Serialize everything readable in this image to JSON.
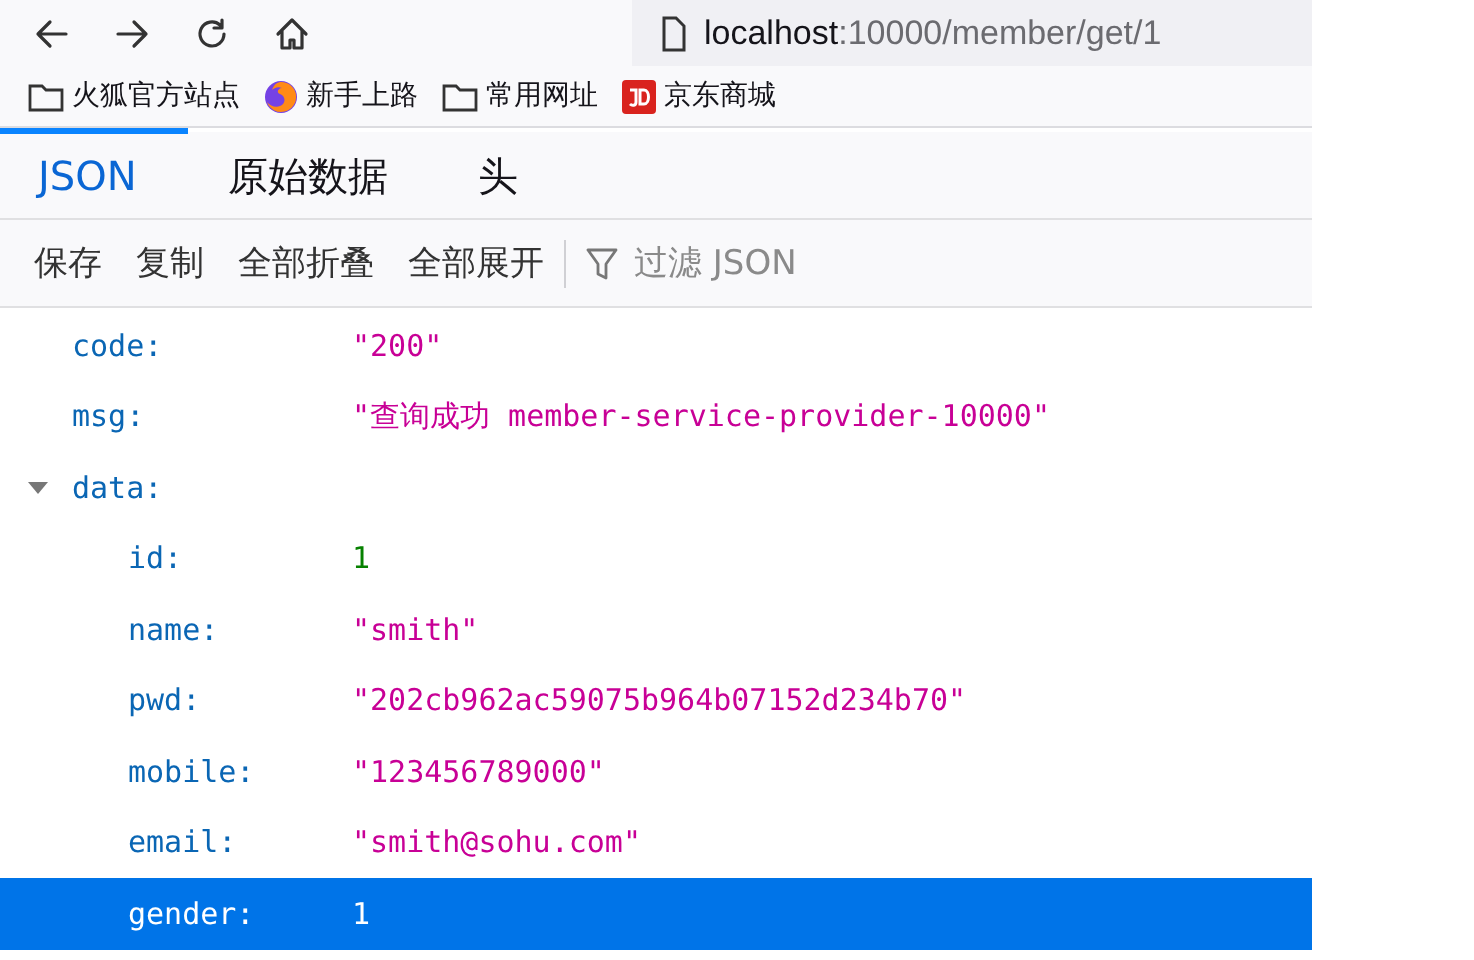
{
  "address_bar": {
    "host": "localhost",
    "path": ":10000/member/get/1"
  },
  "bookmarks": [
    {
      "kind": "folder",
      "label": "火狐官方站点"
    },
    {
      "kind": "firefox",
      "label": "新手上路"
    },
    {
      "kind": "folder",
      "label": "常用网址"
    },
    {
      "kind": "jd",
      "label": "京东商城"
    }
  ],
  "tabs": [
    {
      "label": "JSON",
      "selected": true
    },
    {
      "label": "原始数据",
      "selected": false
    },
    {
      "label": "头",
      "selected": false
    }
  ],
  "toolbar": {
    "buttons": [
      "保存",
      "复制",
      "全部折叠",
      "全部展开"
    ],
    "filter": {
      "placeholder": "过滤 JSON"
    }
  },
  "tree": [
    {
      "key": "code:",
      "value": "\"200\"",
      "kind": "string",
      "selected": false
    },
    {
      "key": "msg:",
      "value": "\"查询成功 member-service-provider-10000\"",
      "kind": "string",
      "selected": false
    },
    {
      "key": "data:",
      "kind": "object",
      "expanded": true,
      "selected": false,
      "children": [
        {
          "key": "id:",
          "value": "1",
          "kind": "number",
          "selected": false
        },
        {
          "key": "name:",
          "value": "\"smith\"",
          "kind": "string",
          "selected": false
        },
        {
          "key": "pwd:",
          "value": "\"202cb962ac59075b964b07152d234b70\"",
          "kind": "string",
          "selected": false
        },
        {
          "key": "mobile:",
          "value": "\"123456789000\"",
          "kind": "string",
          "selected": false
        },
        {
          "key": "email:",
          "value": "\"smith@sohu.com\"",
          "kind": "string",
          "selected": false
        },
        {
          "key": "gender:",
          "value": "1",
          "kind": "number",
          "selected": true
        }
      ]
    }
  ]
}
